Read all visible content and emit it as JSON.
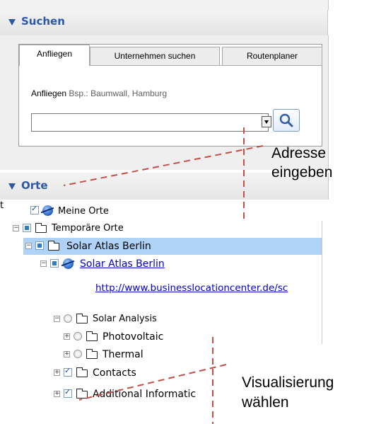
{
  "suchen_panel": {
    "title": "Suchen",
    "tabs": [
      "Anfliegen",
      "Unternehmen suchen",
      "Routenplaner"
    ],
    "fly_label": "Anfliegen",
    "fly_hint": "Bsp.: Baumwall, Hamburg",
    "address_value": "",
    "search_icon": "magnifier-icon"
  },
  "orte_panel": {
    "title": "Orte",
    "tree": {
      "meine_orte": "Meine Orte",
      "temporaere_orte": "Temporäre Orte",
      "solar_atlas_root": "Solar Atlas Berlin",
      "solar_atlas_link": "Solar Atlas Berlin",
      "solar_atlas_url": "http://www.businesslocationcenter.de/sc",
      "solar_analysis": "Solar Analysis",
      "photovoltaic": "Photovoltaic",
      "thermal": "Thermal",
      "contacts": "Contacts",
      "additional_information": "Additional Informatic"
    },
    "clipped_char": "t"
  },
  "annotations": {
    "address_line1": "Adresse",
    "address_line2": "eingeben",
    "visual_line1": "Visualisierung",
    "visual_line2": "wählen",
    "line_color": "#c44f47"
  }
}
